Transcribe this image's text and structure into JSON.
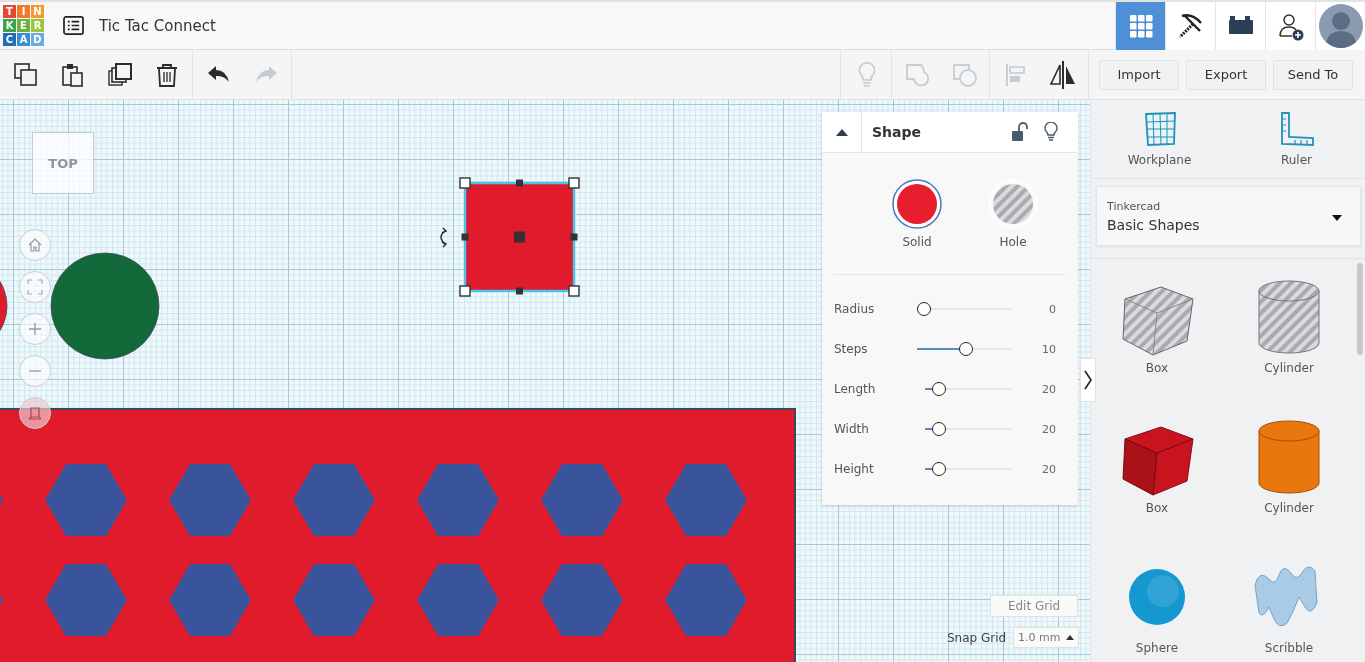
{
  "header": {
    "logo": {
      "letters": [
        {
          "char": "T",
          "color": "#e4472f"
        },
        {
          "char": "I",
          "color": "#ee7a2a"
        },
        {
          "char": "N",
          "color": "#f39a34"
        },
        {
          "char": "K",
          "color": "#3fa24a"
        },
        {
          "char": "E",
          "color": "#6cb43f"
        },
        {
          "char": "R",
          "color": "#9cc53b"
        },
        {
          "char": "C",
          "color": "#1f6fb3"
        },
        {
          "char": "A",
          "color": "#3a8fd0"
        },
        {
          "char": "D",
          "color": "#68aee0"
        }
      ]
    },
    "title": "Tic Tac Connect",
    "nav": [
      {
        "kind": "grid",
        "selected": true
      },
      {
        "kind": "pickaxe",
        "selected": false
      },
      {
        "kind": "bricks",
        "selected": false
      },
      {
        "kind": "add-user",
        "selected": false
      },
      {
        "kind": "avatar",
        "selected": false
      }
    ]
  },
  "toolbar": {
    "left_groups": [
      {
        "tools": [
          {
            "kind": "copy",
            "disabled": false
          },
          {
            "kind": "paste",
            "disabled": false
          },
          {
            "kind": "duplicate",
            "disabled": false
          },
          {
            "kind": "delete",
            "disabled": false
          }
        ]
      },
      {
        "tools": [
          {
            "kind": "undo",
            "disabled": false
          },
          {
            "kind": "redo",
            "disabled": true
          }
        ]
      }
    ],
    "right_groups": [
      {
        "tools": [
          {
            "kind": "light",
            "disabled": true
          }
        ]
      },
      {
        "tools": [
          {
            "kind": "group",
            "disabled": true
          },
          {
            "kind": "ungroup",
            "disabled": true
          }
        ]
      },
      {
        "tools": [
          {
            "kind": "align",
            "disabled": true
          },
          {
            "kind": "mirror",
            "disabled": false
          }
        ]
      }
    ],
    "buttons": [
      "Import",
      "Export",
      "Send To"
    ]
  },
  "canvas": {
    "view_cube": "TOP",
    "view_controls": [
      {
        "kind": "home"
      },
      {
        "kind": "fit"
      },
      {
        "kind": "zoom-in"
      },
      {
        "kind": "zoom-out"
      },
      {
        "kind": "ortho"
      }
    ],
    "objects": [
      {
        "kind": "circle",
        "color": "#e01b2c",
        "selected": false
      },
      {
        "kind": "circle",
        "color": "#13693a",
        "selected": false
      },
      {
        "kind": "box",
        "color": "#e01b2c",
        "selected": true
      },
      {
        "kind": "hex-plate",
        "color": "#e01b2c",
        "selected": false
      }
    ],
    "edit_grid": "Edit Grid",
    "snap_label": "Snap Grid",
    "snap_value": "1.0 mm"
  },
  "shape_panel": {
    "title": "Shape",
    "locked": false,
    "types": [
      {
        "kind": "solid",
        "label": "Solid",
        "color": "#e61e2e",
        "selected": true
      },
      {
        "kind": "hole",
        "label": "Hole",
        "selected": false
      }
    ],
    "params": [
      {
        "label": "Radius",
        "level": 0,
        "reading": "0"
      },
      {
        "label": "Steps",
        "level": 0.52,
        "reading": "10"
      },
      {
        "label": "Length",
        "level": 0.1,
        "reading": "20"
      },
      {
        "label": "Width",
        "level": 0.1,
        "reading": "20"
      },
      {
        "label": "Height",
        "level": 0.1,
        "reading": "20"
      }
    ]
  },
  "sidebar": {
    "tools": [
      {
        "kind": "workplane",
        "label": "Workplane"
      },
      {
        "kind": "ruler",
        "label": "Ruler"
      }
    ],
    "library": {
      "label": "Tinkercad",
      "value": "Basic Shapes"
    },
    "shapes": [
      {
        "kind": "box",
        "label": "Box",
        "hole": true
      },
      {
        "kind": "cylinder",
        "label": "Cylinder",
        "hole": true
      },
      {
        "kind": "box",
        "label": "Box",
        "hole": false,
        "color": "#c8141e"
      },
      {
        "kind": "cylinder",
        "label": "Cylinder",
        "hole": false,
        "color": "#e8770e"
      },
      {
        "kind": "sphere",
        "label": "Sphere",
        "hole": false,
        "color": "#1597cf"
      },
      {
        "kind": "scribble",
        "label": "Scribble",
        "hole": false,
        "color": "#a9cbe6"
      }
    ]
  }
}
